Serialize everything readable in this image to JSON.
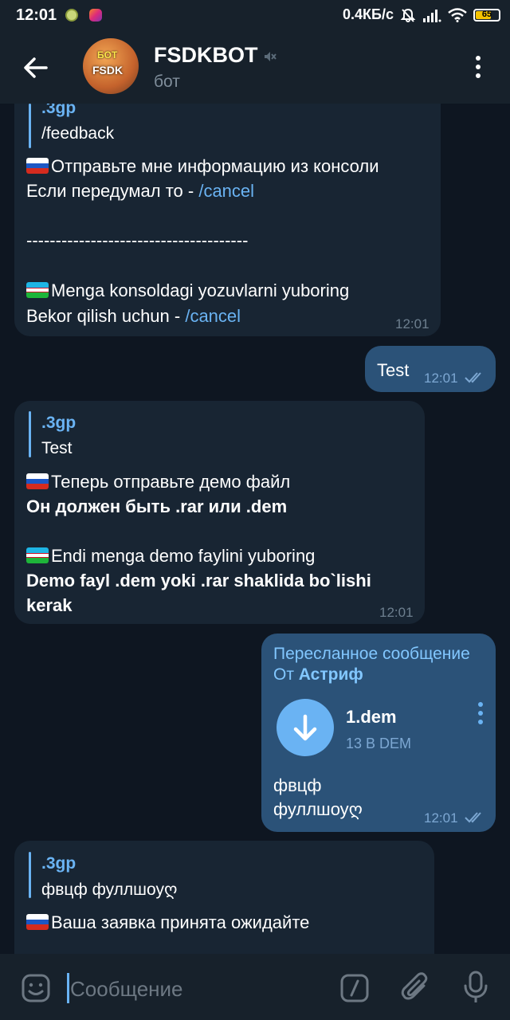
{
  "status": {
    "time": "12:01",
    "speed": "0.4КБ/с",
    "battery": "65"
  },
  "header": {
    "title": "FSDKBOT",
    "subtitle": "бот",
    "avatar_top": "БОТ",
    "avatar_bottom": "FSDK"
  },
  "messages": {
    "m1": {
      "reply_name": ".3gp",
      "reply_text": "/feedback",
      "line1": "Отправьте мне информацию из консоли",
      "line2_prefix": "Если передумал то - ",
      "line2_link": "/cancel",
      "divider": "--------------------------------------",
      "line3": "Menga konsoldagi yozuvlarni yuboring",
      "line4_prefix": "Bekor qilish uchun - ",
      "line4_link": "/cancel",
      "time": "12:01"
    },
    "m2": {
      "text": "Test",
      "time": "12:01"
    },
    "m3": {
      "reply_name": ".3gp",
      "reply_text": "Test",
      "line1": "Теперь отправьте демо файл",
      "line2": "Он должен быть .rar или .dem",
      "line3": "Endi menga demo faylini yuboring",
      "line4": "Demo fayl .dem yoki .rar shaklida bo`lishi",
      "line5": "kerak",
      "time": "12:01"
    },
    "m4": {
      "forward_label": "Пересланное сообщение",
      "forward_from_prefix": "От ",
      "forward_from_name": "Астриф",
      "file_name": "1.dem",
      "file_size": "13 B DEM",
      "caption1": "фвцф",
      "caption2": "фуллшоуღ",
      "time": "12:01"
    },
    "m5": {
      "reply_name": ".3gp",
      "reply_text": "фвцф фуллшоуღ",
      "line1": "Ваша заявка принята ожидайте"
    }
  },
  "input": {
    "placeholder": "Сообщение"
  },
  "colors": {
    "bg": "#0e1621",
    "bar": "#17212b",
    "incoming": "#182533",
    "outgoing": "#2b5278",
    "accent": "#6ab3f3"
  }
}
